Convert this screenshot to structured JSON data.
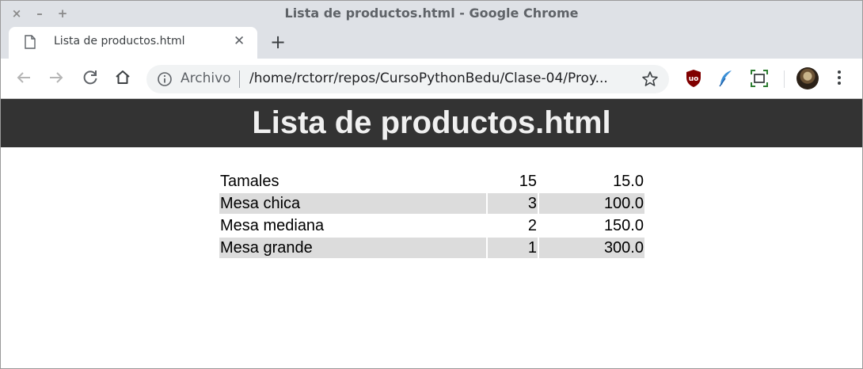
{
  "window": {
    "title": "Lista de productos.html - Google Chrome",
    "controls": {
      "close": "×",
      "minimize": "–",
      "maximize": "+"
    }
  },
  "tab": {
    "title": "Lista de productos.html",
    "close_glyph": "✕",
    "new_tab_glyph": "+"
  },
  "toolbar": {
    "scheme_label": "Archivo",
    "url": "/home/rctorr/repos/CursoPythonBedu/Clase-04/Proy..."
  },
  "extensions": [
    "ublock-origin-icon",
    "feather-extension-icon",
    "screenshot-extension-icon"
  ],
  "page": {
    "heading": "Lista de productos.html",
    "products": [
      {
        "name": "Tamales",
        "quantity": "15",
        "price": "15.0"
      },
      {
        "name": "Mesa chica",
        "quantity": "3",
        "price": "100.0"
      },
      {
        "name": "Mesa mediana",
        "quantity": "2",
        "price": "150.0"
      },
      {
        "name": "Mesa grande",
        "quantity": "1",
        "price": "300.0"
      }
    ]
  },
  "colors": {
    "header_bg": "#333333",
    "row_shade": "#dcdcdc",
    "chrome_frame": "#dee1e6"
  }
}
